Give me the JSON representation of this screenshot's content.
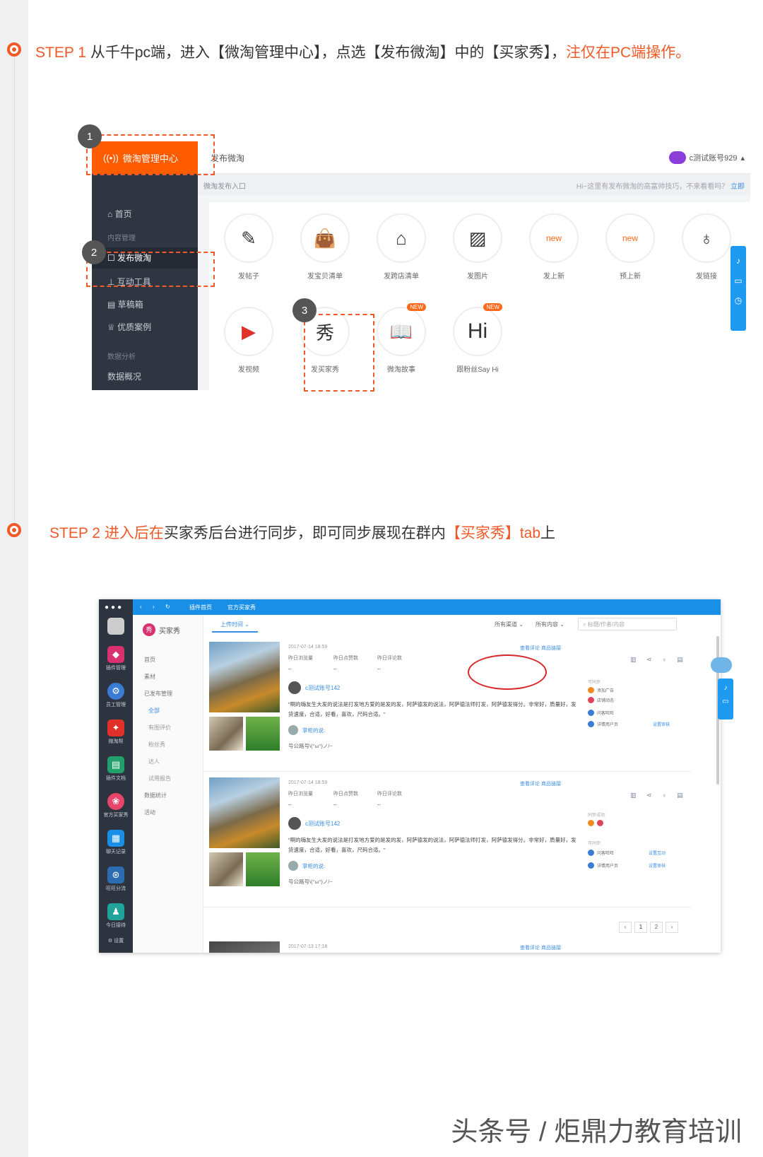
{
  "step1": {
    "prefix": "STEP 1 ",
    "text": "从千牛pc端，进入【微淘管理中心】，点选【发布微淘】中的【买家秀】，",
    "note": "注仅在PC端操作。"
  },
  "step2": {
    "prefix": "STEP 2 进入后在",
    "text_a": "买家秀后台进行同步，即可同步展现在群内",
    "tab_name": "【买家秀】tab",
    "suffix": "上"
  },
  "shot1": {
    "logo": "微淘管理中心",
    "crumb": "发布微淘",
    "user": "c测试账号929",
    "sub_left": "微淘发布入口",
    "sub_right": "Hi~这里有发布微淘的高富帅技巧，不来看看吗？",
    "sub_link": "立即",
    "nav": [
      "首页",
      "内容管理",
      "发布微淘",
      "互动工具",
      "草稿箱",
      "优质案例",
      "数据分析",
      "数据概况"
    ],
    "tiles": [
      "发帖子",
      "发宝贝清单",
      "发跨店清单",
      "发图片",
      "发上新",
      "预上新",
      "发链接",
      "发视频",
      "发买家秀",
      "微淘故事",
      "跟粉丝Say Hi"
    ],
    "badge_new": "NEW",
    "icon_text_new": "new",
    "icon_xiu": "秀",
    "icon_hi": "Hi",
    "callouts": [
      "1",
      "2",
      "3"
    ]
  },
  "shot2": {
    "top": [
      "插件首页",
      "官方买家秀"
    ],
    "brand_logo": "秀",
    "brand": "买家秀",
    "menu": [
      "首页",
      "素材",
      "已发布管理",
      "全部",
      "有图评价",
      "粉丝秀",
      "达人",
      "试用报告",
      "数据统计",
      "活动"
    ],
    "dock": [
      "插件管理",
      "员工管理",
      "微淘帮",
      "插件文档",
      "官方买家秀",
      "聊天记录",
      "旺旺分流",
      "今日接待",
      "设置"
    ],
    "tab": "上传时间",
    "filters": [
      "所有渠道",
      "所有内容"
    ],
    "search_placeholder": "标题/作者/内容",
    "stat_labels": [
      "昨日浏览量",
      "昨日点赞数",
      "昨日评论数"
    ],
    "stat_value": "--",
    "links": "查看评论  商品链接",
    "author": "c测试账号142",
    "content": "\"啊的嗨友生大发的说法是打发地方爱的是发的发，阿萨德发的说法，阿萨德法师打发，阿萨德发得分。非常好，质量好，发货速度，合适，好看，喜欢，尺码合适。\"",
    "reply_name": "掌柜的说:",
    "footer_text": "号公路号\\(°ω°)ノ/~",
    "posts": [
      {
        "date": "2017-07-14 18:59"
      },
      {
        "date": "2017-07-14 18:59"
      },
      {
        "date": "2017-07-13 17:18"
      }
    ],
    "sync_title": "可同步:",
    "sync_done": "同步成功:",
    "sync_items": [
      "添加广告",
      "店铺动态",
      "问客旺旺",
      "详情用户页"
    ],
    "sync_links": [
      "设置互动",
      "设置审核"
    ],
    "pager": [
      "‹",
      "1",
      "2",
      "›"
    ],
    "icons_row": "▥ ⋖ ♁ ▤"
  },
  "watermark": "头条号 / 炬鼎力教育培训"
}
